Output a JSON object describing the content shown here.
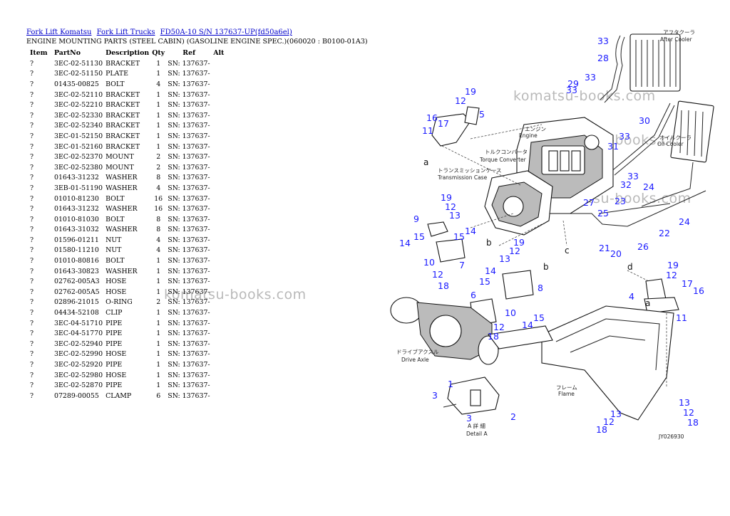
{
  "breadcrumb": [
    "Fork Lift Komatsu",
    "Fork Lift Trucks",
    "FD50A-10 S/N 137637-UP(fd50a6el)"
  ],
  "subtitle": "ENGINE MOUNTING PARTS (STEEL CABIN) (GASOLINE ENGINE SPEC.)(060020 : B0100-01A3)",
  "table": {
    "headers": [
      "Item",
      "PartNo",
      "Description",
      "Qty",
      "Ref",
      "Alt"
    ],
    "rows": [
      [
        "?",
        "3EC-02-51130",
        "BRACKET",
        "1",
        "SN: 137637-",
        ""
      ],
      [
        "?",
        "3EC-02-51150",
        "PLATE",
        "1",
        "SN: 137637-",
        ""
      ],
      [
        "?",
        "01435-00825",
        "BOLT",
        "4",
        "SN: 137637-",
        ""
      ],
      [
        "?",
        "3EC-02-52110",
        "BRACKET",
        "1",
        "SN: 137637-",
        ""
      ],
      [
        "?",
        "3EC-02-52210",
        "BRACKET",
        "1",
        "SN: 137637-",
        ""
      ],
      [
        "?",
        "3EC-02-52330",
        "BRACKET",
        "1",
        "SN: 137637-",
        ""
      ],
      [
        "?",
        "3EC-02-52340",
        "BRACKET",
        "1",
        "SN: 137637-",
        ""
      ],
      [
        "?",
        "3EC-01-52150",
        "BRACKET",
        "1",
        "SN: 137637-",
        ""
      ],
      [
        "?",
        "3EC-01-52160",
        "BRACKET",
        "1",
        "SN: 137637-",
        ""
      ],
      [
        "?",
        "3EC-02-52370",
        "MOUNT",
        "2",
        "SN: 137637-",
        ""
      ],
      [
        "?",
        "3EC-02-52380",
        "MOUNT",
        "2",
        "SN: 137637-",
        ""
      ],
      [
        "?",
        "01643-31232",
        "WASHER",
        "8",
        "SN: 137637-",
        ""
      ],
      [
        "?",
        "3EB-01-51190",
        "WASHER",
        "4",
        "SN: 137637-",
        ""
      ],
      [
        "?",
        "01010-81230",
        "BOLT",
        "16",
        "SN: 137637-",
        ""
      ],
      [
        "?",
        "01643-31232",
        "WASHER",
        "16",
        "SN: 137637-",
        ""
      ],
      [
        "?",
        "01010-81030",
        "BOLT",
        "8",
        "SN: 137637-",
        ""
      ],
      [
        "?",
        "01643-31032",
        "WASHER",
        "8",
        "SN: 137637-",
        ""
      ],
      [
        "?",
        "01596-01211",
        "NUT",
        "4",
        "SN: 137637-",
        ""
      ],
      [
        "?",
        "01580-11210",
        "NUT",
        "4",
        "SN: 137637-",
        ""
      ],
      [
        "?",
        "01010-80816",
        "BOLT",
        "1",
        "SN: 137637-",
        ""
      ],
      [
        "?",
        "01643-30823",
        "WASHER",
        "1",
        "SN: 137637-",
        ""
      ],
      [
        "?",
        "02762-005A3",
        "HOSE",
        "1",
        "SN: 137637-",
        ""
      ],
      [
        "?",
        "02762-005A5",
        "HOSE",
        "1",
        "SN: 137637-",
        ""
      ],
      [
        "?",
        "02896-21015",
        "O-RING",
        "2",
        "SN: 137637-",
        ""
      ],
      [
        "?",
        "04434-52108",
        "CLIP",
        "1",
        "SN: 137637-",
        ""
      ],
      [
        "?",
        "3EC-04-51710",
        "PIPE",
        "1",
        "SN: 137637-",
        ""
      ],
      [
        "?",
        "3EC-04-51770",
        "PIPE",
        "1",
        "SN: 137637-",
        ""
      ],
      [
        "?",
        "3EC-02-52940",
        "PIPE",
        "1",
        "SN: 137637-",
        ""
      ],
      [
        "?",
        "3EC-02-52990",
        "HOSE",
        "1",
        "SN: 137637-",
        ""
      ],
      [
        "?",
        "3EC-02-52920",
        "PIPE",
        "1",
        "SN: 137637-",
        ""
      ],
      [
        "?",
        "3EC-02-52980",
        "HOSE",
        "1",
        "SN: 137637-",
        ""
      ],
      [
        "?",
        "3EC-02-52870",
        "PIPE",
        "1",
        "SN: 137637-",
        ""
      ],
      [
        "?",
        "07289-00055",
        "CLAMP",
        "6",
        "SN: 137637-",
        ""
      ]
    ]
  },
  "watermark": "komatsu-books.com",
  "diagram": {
    "labels_jp": {
      "after_cooler_jp": "アフタクーラ",
      "after_cooler": "After Cooler",
      "engine_jp": "エンジン",
      "engine": "Engine",
      "oil_cooler_jp": "オイルクーラ",
      "oil_cooler": "Oil Cooler",
      "torque_converter_jp": "トルクコンバータ",
      "torque_converter": "Torque Converter",
      "transmission_case_jp": "トランスミッションケース",
      "transmission_case": "Transmission Case",
      "drive_axle_jp": "ドライブアクスル",
      "drive_axle": "Drive Axle",
      "frame_jp": "フレーム",
      "frame": "Flame",
      "detail_jp": "A 詳 細",
      "detail": "Detail A",
      "drawing_no": "JY026930"
    },
    "callouts": [
      {
        "t": "33"
      },
      {
        "t": "28"
      },
      {
        "t": "29"
      },
      {
        "t": "33"
      },
      {
        "t": "33"
      },
      {
        "t": "19"
      },
      {
        "t": "12"
      },
      {
        "t": "16"
      },
      {
        "t": "5"
      },
      {
        "t": "17"
      },
      {
        "t": "11"
      },
      {
        "t": "a"
      },
      {
        "t": "30"
      },
      {
        "t": "31"
      },
      {
        "t": "33"
      },
      {
        "t": "32"
      },
      {
        "t": "33"
      },
      {
        "t": "24"
      },
      {
        "t": "23"
      },
      {
        "t": "24"
      },
      {
        "t": "22"
      },
      {
        "t": "27"
      },
      {
        "t": "25"
      },
      {
        "t": "26"
      },
      {
        "t": "21"
      },
      {
        "t": "20"
      },
      {
        "t": "19"
      },
      {
        "t": "12"
      },
      {
        "t": "13"
      },
      {
        "t": "9"
      },
      {
        "t": "15"
      },
      {
        "t": "14"
      },
      {
        "t": "15"
      },
      {
        "t": "14"
      },
      {
        "t": "b"
      },
      {
        "t": "c"
      },
      {
        "t": "19"
      },
      {
        "t": "12"
      },
      {
        "t": "13"
      },
      {
        "t": "10"
      },
      {
        "t": "7"
      },
      {
        "t": "12"
      },
      {
        "t": "18"
      },
      {
        "t": "14"
      },
      {
        "t": "15"
      },
      {
        "t": "b"
      },
      {
        "t": "8"
      },
      {
        "t": "6"
      },
      {
        "t": "10"
      },
      {
        "t": "12"
      },
      {
        "t": "18"
      },
      {
        "t": "14"
      },
      {
        "t": "15"
      },
      {
        "t": "d"
      },
      {
        "t": "19"
      },
      {
        "t": "12"
      },
      {
        "t": "4"
      },
      {
        "t": "a"
      },
      {
        "t": "17"
      },
      {
        "t": "16"
      },
      {
        "t": "11"
      },
      {
        "t": "1"
      },
      {
        "t": "3"
      },
      {
        "t": "3"
      },
      {
        "t": "2"
      },
      {
        "t": "13"
      },
      {
        "t": "12"
      },
      {
        "t": "18"
      },
      {
        "t": "13"
      },
      {
        "t": "12"
      },
      {
        "t": "18"
      }
    ]
  }
}
